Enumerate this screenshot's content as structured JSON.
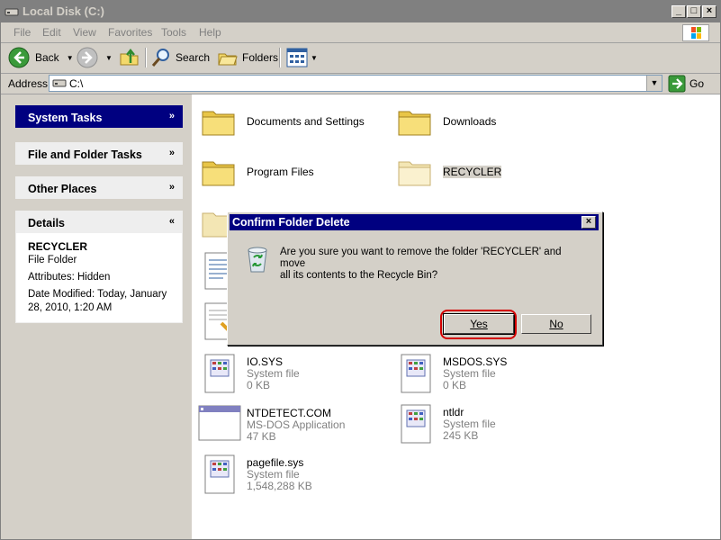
{
  "window": {
    "title": "Local Disk (C:)",
    "controls": {
      "minimize": "_",
      "maximize": "□",
      "close": "×"
    }
  },
  "menu": [
    "File",
    "Edit",
    "View",
    "Favorites",
    "Tools",
    "Help"
  ],
  "toolbar": {
    "back": "Back",
    "search": "Search",
    "folders": "Folders"
  },
  "address": {
    "label": "Address",
    "value": "C:\\",
    "go": "Go"
  },
  "left_pane": {
    "system_tasks": "System Tasks",
    "file_folder_tasks": "File and Folder Tasks",
    "other_places": "Other Places",
    "details": "Details",
    "details_body": {
      "name": "RECYCLER",
      "type": "File Folder",
      "attributes": "Attributes: Hidden",
      "modified_line1": "Date Modified: Today, January",
      "modified_line2": "28, 2010, 1:20 AM"
    }
  },
  "items": {
    "documents_and_settings": "Documents and Settings",
    "downloads": "Downloads",
    "program_files": "Program Files",
    "recycler": "RECYCLER",
    "io_sys": {
      "name": "IO.SYS",
      "type": "System file",
      "size": "0 KB"
    },
    "msdos_sys": {
      "name": "MSDOS.SYS",
      "type": "System file",
      "size": "0 KB"
    },
    "ntdetect": {
      "name": "NTDETECT.COM",
      "type": "MS-DOS Application",
      "size": "47 KB"
    },
    "ntldr": {
      "name": "ntldr",
      "type": "System file",
      "size": "245 KB"
    },
    "pagefile": {
      "name": "pagefile.sys",
      "type": "System file",
      "size": "1,548,288 KB"
    }
  },
  "dialog": {
    "title": "Confirm Folder Delete",
    "message_line1": "Are you sure you want to remove the folder 'RECYCLER' and move",
    "message_line2": "all its contents to the Recycle Bin?",
    "yes": "Yes",
    "no": "No"
  },
  "colors": {
    "titlebar_inactive": "#808080",
    "dialog_title": "#000080",
    "highlight_ring": "#d40000",
    "system_tasks_header": "#000080"
  }
}
